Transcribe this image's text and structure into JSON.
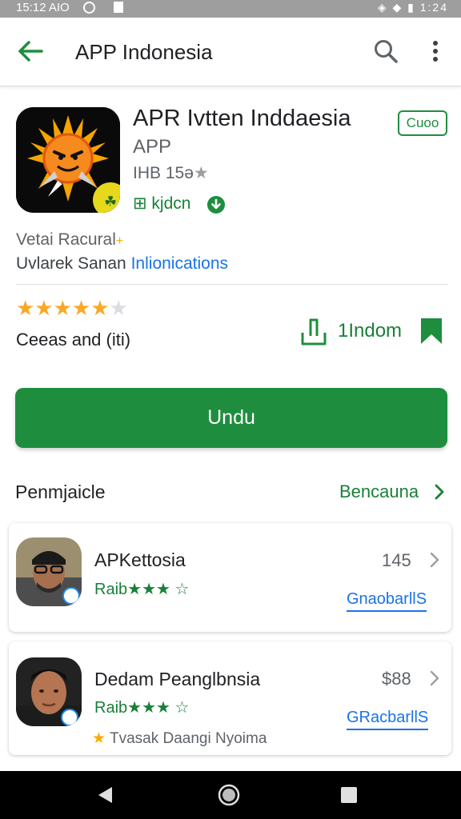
{
  "status_bar": {
    "time": "15:12 AIO",
    "right": "◈ ◆ ▮ 1:24"
  },
  "app_bar": {
    "title": "APP Indonesia"
  },
  "app": {
    "name": "APR Ivtten Inddaesia",
    "subtitle": "APP",
    "size": "IHB 15ə",
    "size_star": "★",
    "developer": "⊞ kjdcn",
    "badge": "Cuoo",
    "desc_line1": "Vetai Racural",
    "desc_line1_mark": "+",
    "desc_line2_prefix": "Uvlarek Sanan",
    "desc_line2_link": "Inlionications",
    "stars_filled": "★★★★★",
    "stars_empty": "★",
    "rating_label": "Ceeas and (iti)",
    "install_count": "1Indom",
    "primary_button": "Undu"
  },
  "section": {
    "title": "Penmjaicle",
    "link": "Bencauna"
  },
  "cards": [
    {
      "title": "APKettosia",
      "sub_prefix": "Raib",
      "sub_stars": "★★★",
      "sub_star_outline": "☆",
      "price": "145",
      "link": "GnaobarllS"
    },
    {
      "title": "Dedam Peanglbnsia",
      "sub_prefix": "Raib",
      "sub_stars": "★★★",
      "sub_star_outline": "☆",
      "price": "$88",
      "link": "GRacbarllS",
      "note_star": "★",
      "note": "Tvasak Daangi Nyoima"
    }
  ],
  "colors": {
    "accent": "#1e8e3e",
    "link": "#1a73e8",
    "star": "#f9a825"
  }
}
